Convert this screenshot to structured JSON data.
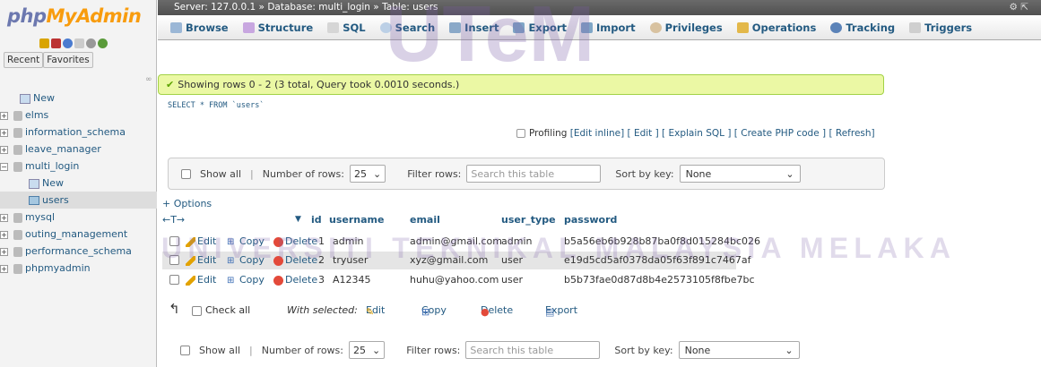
{
  "app": {
    "logo_part1": "php",
    "logo_part2": "MyAdmin"
  },
  "left_tabs": {
    "recent": "Recent",
    "favorites": "Favorites"
  },
  "tree": [
    {
      "label": "New",
      "kind": "new"
    },
    {
      "label": "elms",
      "kind": "db"
    },
    {
      "label": "information_schema",
      "kind": "db"
    },
    {
      "label": "leave_manager",
      "kind": "db"
    },
    {
      "label": "multi_login",
      "kind": "db",
      "expanded": true
    },
    {
      "label": "New",
      "kind": "new-sub"
    },
    {
      "label": "users",
      "kind": "table",
      "selected": true
    },
    {
      "label": "mysql",
      "kind": "db"
    },
    {
      "label": "outing_management",
      "kind": "db"
    },
    {
      "label": "performance_schema",
      "kind": "db"
    },
    {
      "label": "phpmyadmin",
      "kind": "db"
    }
  ],
  "breadcrumb": {
    "server": "Server: 127.0.0.1",
    "database": "Database: multi_login",
    "table": "Table: users"
  },
  "tabs": [
    "Browse",
    "Structure",
    "SQL",
    "Search",
    "Insert",
    "Export",
    "Import",
    "Privileges",
    "Operations",
    "Tracking",
    "Triggers"
  ],
  "notice": "Showing rows 0 - 2 (3 total, Query took 0.0010 seconds.)",
  "sql_query": "SELECT * FROM `users`",
  "profiling": {
    "label": "Profiling",
    "links": "[Edit inline] [ Edit ] [ Explain SQL ] [ Create PHP code ] [ Refresh]"
  },
  "nav": {
    "show_all": "Show all",
    "rows_label": "Number of rows:",
    "rows_value": "25",
    "filter_label": "Filter rows:",
    "filter_placeholder": "Search this table",
    "sort_label": "Sort by key:",
    "sort_value": "None"
  },
  "options": "+ Options",
  "columns": [
    "id",
    "username",
    "email",
    "user_type",
    "password"
  ],
  "actions": {
    "edit": "Edit",
    "copy": "Copy",
    "delete": "Delete"
  },
  "rows": [
    {
      "id": "1",
      "username": "admin",
      "email": "admin@gmail.com",
      "user_type": "admin",
      "password": "b5a56eb6b928b87ba0f8d015284bc026"
    },
    {
      "id": "2",
      "username": "tryuser",
      "email": "xyz@gmail.com",
      "user_type": "user",
      "password": "e19d5cd5af0378da05f63f891c7467af"
    },
    {
      "id": "3",
      "username": "A12345",
      "email": "huhu@yahoo.com",
      "user_type": "user",
      "password": "b5b73fae0d87d8b4e2573105f8fbe7bc"
    }
  ],
  "bulk": {
    "check_all": "Check all",
    "with_selected": "With selected:",
    "edit": "Edit",
    "copy": "Copy",
    "delete": "Delete",
    "export": "Export"
  },
  "watermark": {
    "top": "UTeM",
    "middle": "UNIVERSITI TEKNIKAL MALAYSIA MELAKA"
  },
  "colors": {
    "link": "#235a81",
    "notice_bg": "#ebf8a4",
    "watermark": "#7b5ea7"
  }
}
